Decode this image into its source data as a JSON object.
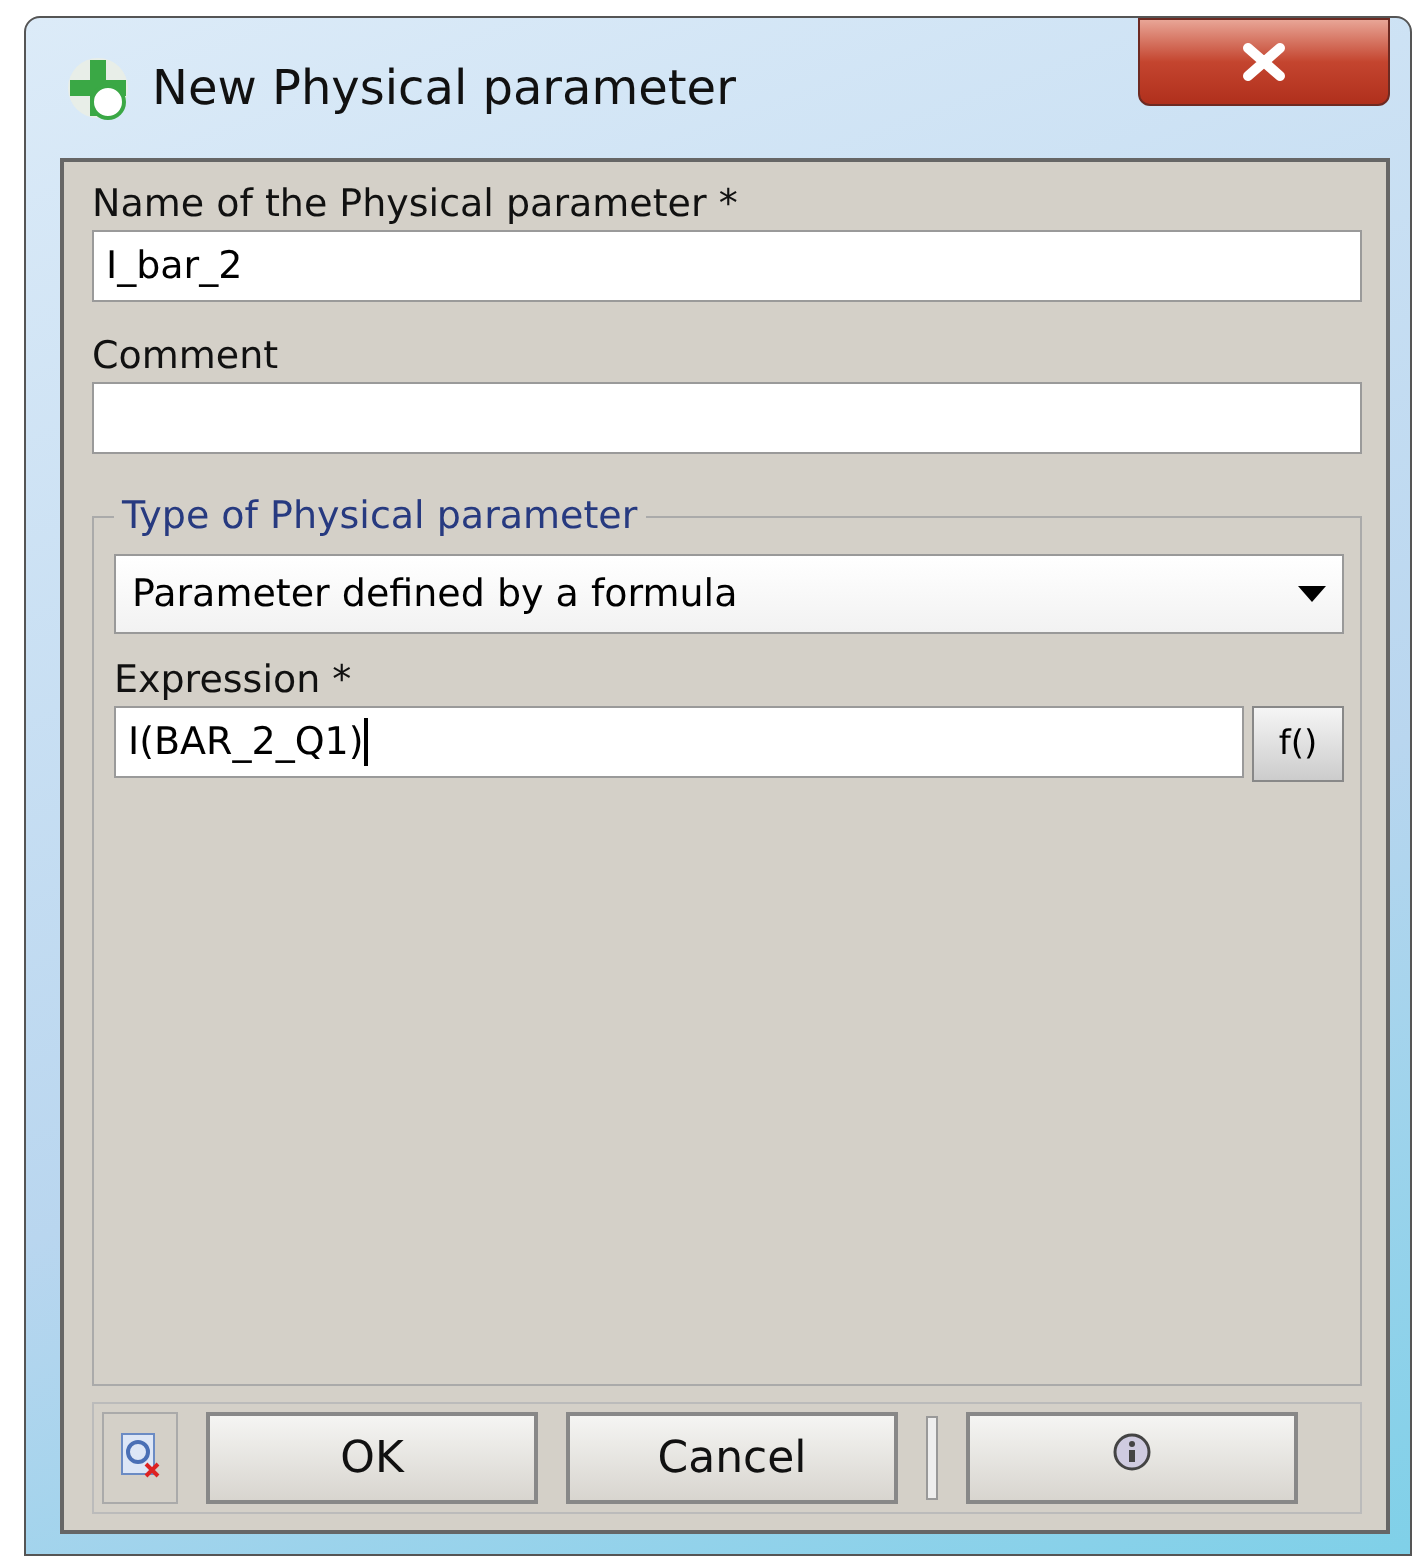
{
  "window": {
    "title": "New Physical parameter"
  },
  "name_field": {
    "label": "Name of the Physical parameter *",
    "value": "I_bar_2"
  },
  "comment_field": {
    "label": "Comment"
  },
  "type_group": {
    "legend": "Type of Physical parameter",
    "dropdown": {
      "value": "Parameter defined by a formula"
    },
    "expression": {
      "label": "Expression *",
      "value": "I(BAR_2_Q1)",
      "focused": true,
      "button": "f()"
    }
  },
  "buttons": [
    {
      "kind": "icon"
    },
    {
      "kind": "text",
      "label": "OK"
    },
    {
      "kind": "text",
      "label": "Cancel"
    },
    {
      "kind": "info"
    }
  ]
}
